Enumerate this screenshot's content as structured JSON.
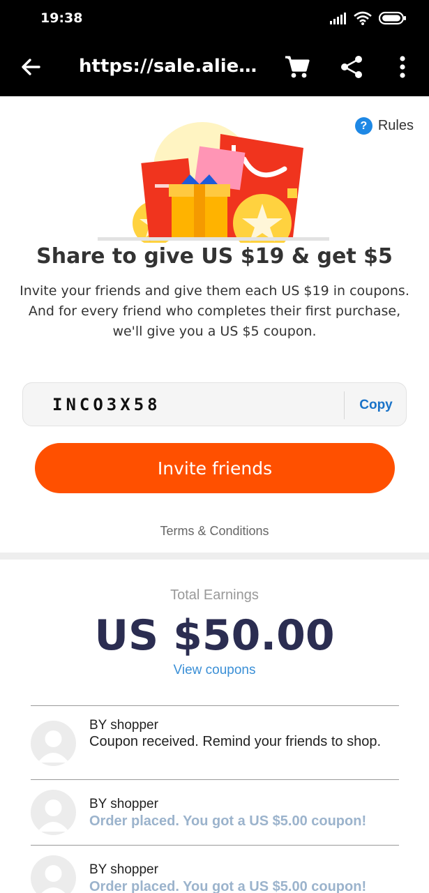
{
  "status_bar": {
    "time": "19:38",
    "icons": [
      "signal-icon",
      "wifi-icon",
      "battery-icon"
    ]
  },
  "toolbar": {
    "url": "https://sale.aliexpr...",
    "icons": [
      "back-arrow-icon",
      "cart-icon",
      "share-icon",
      "more-vert-icon"
    ]
  },
  "rules": {
    "icon_glyph": "?",
    "label": "Rules"
  },
  "promo": {
    "headline": "Share to give US $19 & get $5",
    "description": "Invite your friends and give them each US $19 in coupons. And for every friend who completes their first purchase, we'll give you a US $5 coupon."
  },
  "code_box": {
    "code": "INCO3X58",
    "copy_label": "Copy"
  },
  "invite_button": {
    "label": "Invite friends"
  },
  "terms_link": "Terms & Conditions",
  "earnings": {
    "label": "Total Earnings",
    "value": "US $50.00",
    "view_coupons": "View coupons"
  },
  "feed": [
    {
      "name": "BY shopper",
      "message": "Coupon received. Remind your friends to shop.",
      "highlight": false
    },
    {
      "name": "BY shopper",
      "message": "Order placed. You got a US $5.00 coupon!",
      "highlight": true
    },
    {
      "name": "BY shopper",
      "message": "Order placed. You got a US $5.00 coupon!",
      "highlight": true
    }
  ],
  "colors": {
    "accent": "#ff5000",
    "link_blue": "#1a73c8",
    "earnings_dark": "#2b2d51",
    "muted_highlight": "#9bb3cc"
  }
}
